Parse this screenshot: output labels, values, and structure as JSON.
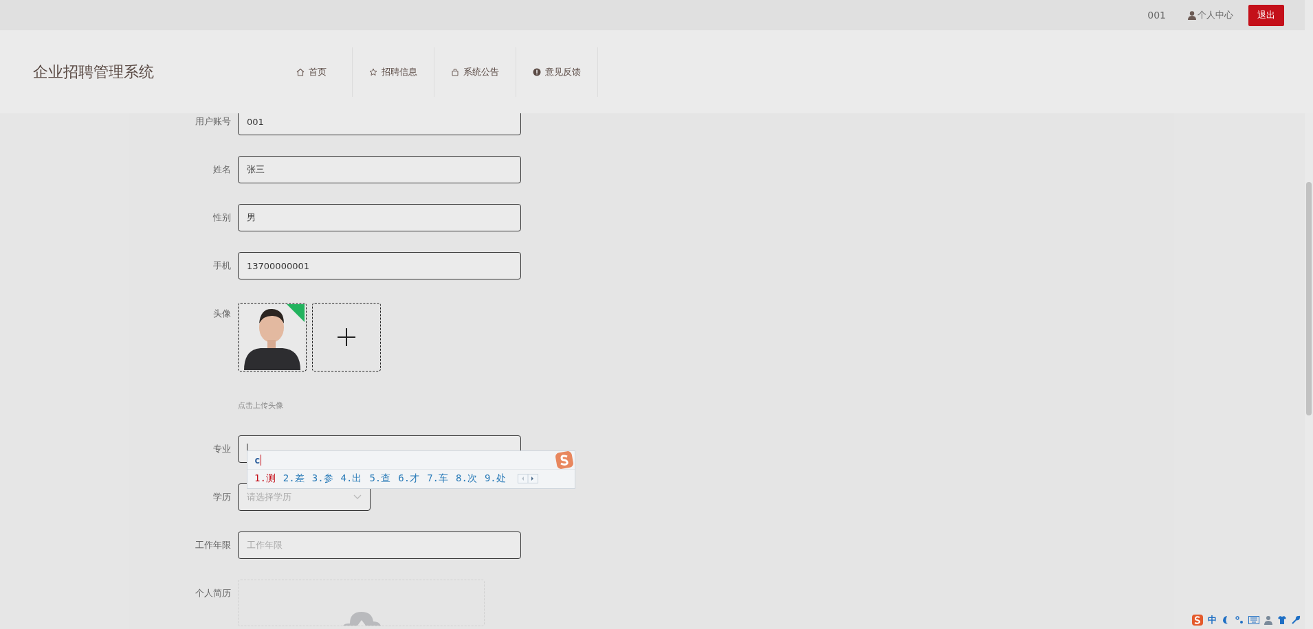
{
  "top_bar": {
    "username": "001",
    "profile_link": "个人中心",
    "logout_button": "退出"
  },
  "header": {
    "title": "企业招聘管理系统",
    "nav": [
      {
        "label": "首页"
      },
      {
        "label": "招聘信息"
      },
      {
        "label": "系统公告"
      },
      {
        "label": "意见反馈"
      }
    ]
  },
  "form": {
    "fields": [
      {
        "kind": "text",
        "label": "用户账号",
        "value": "001"
      },
      {
        "kind": "text",
        "label": "姓名",
        "value": "张三"
      },
      {
        "kind": "text",
        "label": "性别",
        "value": "男"
      },
      {
        "kind": "text",
        "label": "手机",
        "value": "13700000001"
      },
      {
        "label": "头像",
        "hint": "点击上传头像"
      },
      {
        "kind": "text",
        "label": "专业",
        "focused": true
      },
      {
        "kind": "select",
        "label": "学历",
        "placeholder": "请选择学历"
      },
      {
        "kind": "text",
        "label": "工作年限",
        "placeholder": "工作年限"
      },
      {
        "kind": "upload",
        "label": "个人简历"
      }
    ]
  },
  "ime_popup": {
    "composition": "c",
    "candidates": [
      {
        "text": "1.测",
        "selected": true
      },
      {
        "text": "2.差",
        "selected": false
      },
      {
        "text": "3.参",
        "selected": false
      },
      {
        "text": "4.出",
        "selected": false
      },
      {
        "text": "5.查",
        "selected": false
      },
      {
        "text": "6.才",
        "selected": false
      },
      {
        "text": "7.车",
        "selected": false
      },
      {
        "text": "8.次",
        "selected": false
      },
      {
        "text": "9.处",
        "selected": false
      }
    ]
  },
  "ime_toolbar": {
    "mode": "中"
  }
}
